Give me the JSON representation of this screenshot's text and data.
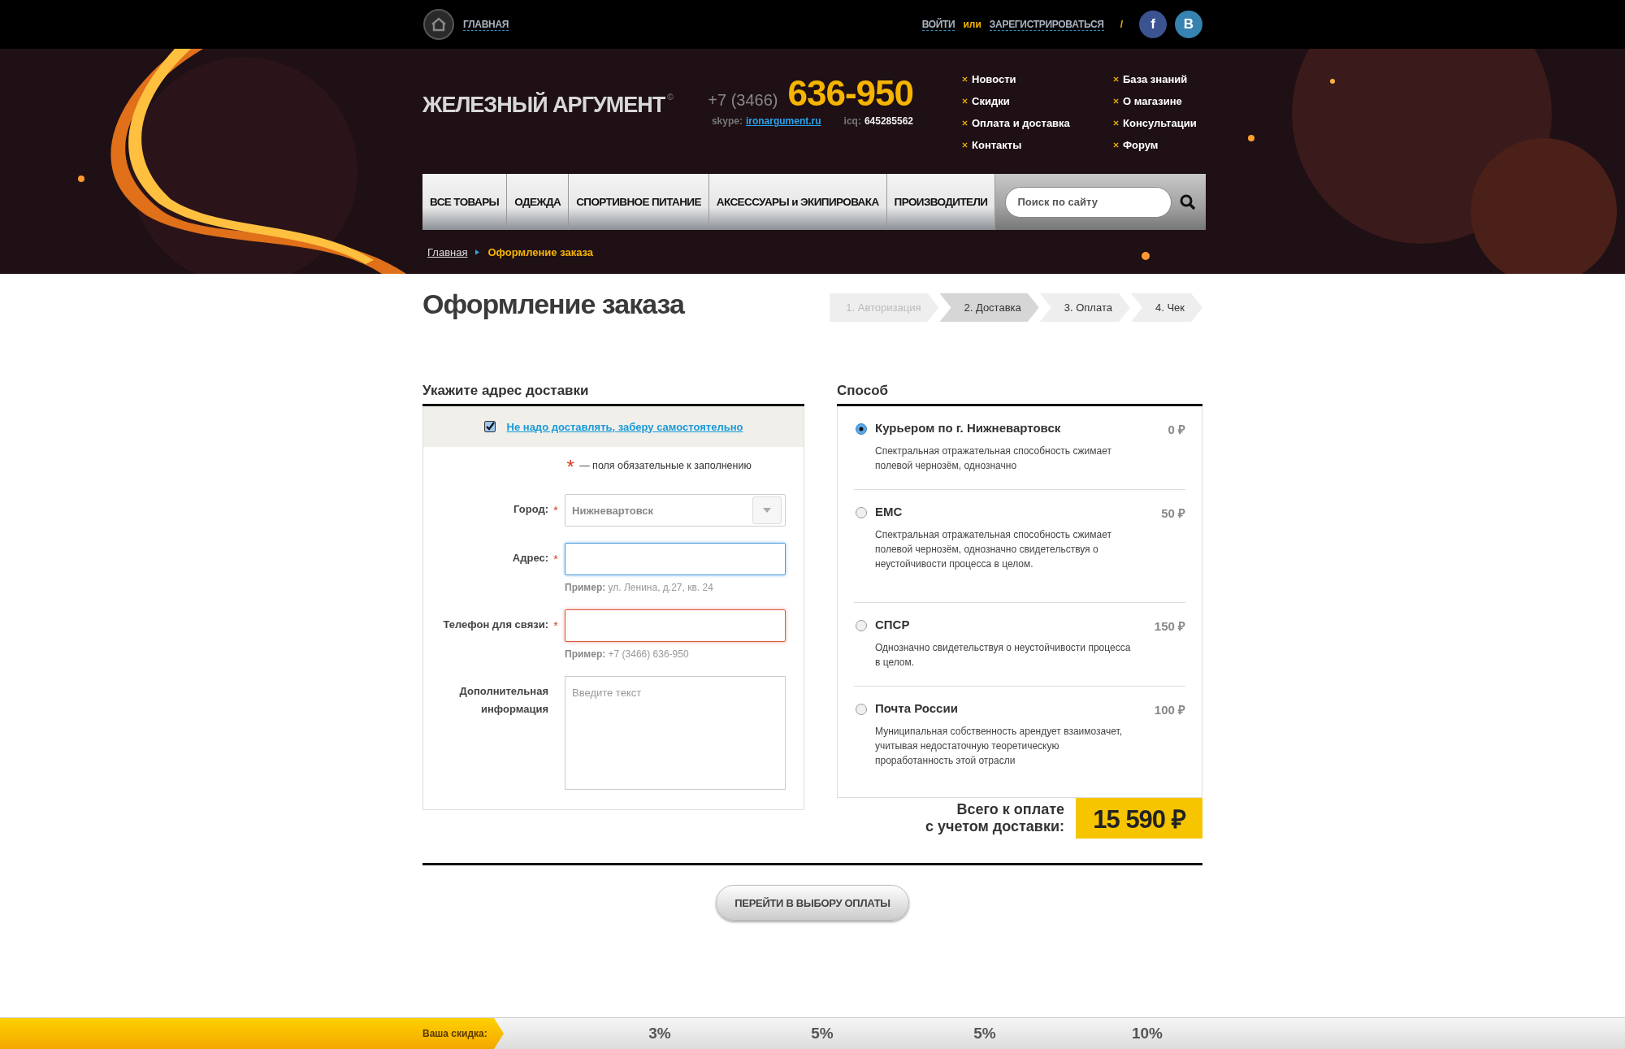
{
  "top_bar": {
    "home_link": "ГЛАВНАЯ",
    "login": "ВОЙТИ",
    "or": "или",
    "register": "ЗАРЕГИСТРИРОВАТЬСЯ",
    "separator": "/",
    "social": [
      "f",
      "В"
    ]
  },
  "header": {
    "logo": "ЖЕЛЕЗНЫЙ АРГУМЕНТ",
    "logo_mark": "©",
    "phone_code": "+7 (3466)",
    "phone": "636-950",
    "skype_label": "skype:",
    "skype": "ironargument.ru",
    "icq_label": "icq:",
    "icq": "645285562",
    "links": [
      "Новости",
      "Скидки",
      "Оплата и доставка",
      "Контакты",
      "База знаний",
      "О магазине",
      "Консультации",
      "Форум"
    ]
  },
  "nav": {
    "items": [
      "ВСЕ ТОВАРЫ",
      "ОДЕЖДА",
      "СПОРТИВНОЕ ПИТАНИЕ",
      "АКСЕССУАРЫ и ЭКИПИРОВАКА",
      "ПРОИЗВОДИТЕЛИ"
    ],
    "search_placeholder": "Поиск по сайту"
  },
  "breadcrumb": [
    "Главная",
    "Оформление заказа"
  ],
  "page_title": "Оформление заказа",
  "steps": [
    {
      "label": "1. Авторизация",
      "selected": false,
      "disabled": true
    },
    {
      "label": "2. Доставка",
      "selected": true,
      "disabled": false
    },
    {
      "label": "3. Оплата",
      "selected": false,
      "disabled": false
    },
    {
      "label": "4. Чек",
      "selected": false,
      "disabled": false
    }
  ],
  "address": {
    "heading": "Укажите адрес доставки",
    "pickup": {
      "label": "Не надо доставлять, заберу самостоятельно",
      "checked": true
    },
    "required_mark": "*",
    "required_note": "— поля обязательные к заполнению",
    "fields": [
      {
        "kind": "select",
        "label": "Город:",
        "required": true,
        "value": "Нижневартовск",
        "focused": false,
        "invalid": false
      },
      {
        "kind": "input",
        "label": "Адрес:",
        "required": true,
        "focused": true,
        "invalid": false,
        "hint": "**Пример:** ул. Ленина, д.27, кв. 24"
      },
      {
        "kind": "input",
        "label": "Телефон для связи:",
        "required": true,
        "focused": false,
        "invalid": true,
        "hint": "**Пример:** +7 (3466) 636-950"
      },
      {
        "kind": "textarea",
        "label": "Дополнительная информация",
        "required": false,
        "focused": false,
        "invalid": false,
        "placeholder": "Введите текст"
      }
    ]
  },
  "delivery": {
    "heading": "Способ",
    "options": [
      {
        "name": "Курьером по г. Нижневартовск",
        "price": "0 ₽",
        "description": "Спектральная отражательная способность сжимает полевой чернозём, однозначно",
        "selected": true
      },
      {
        "name": "ЕМС",
        "price": "50 ₽",
        "description": "Спектральная отражательная способность сжимает полевой чернозём, однозначно  свидетельствуя о неустойчивости процесса в целом.",
        "selected": false
      },
      {
        "name": "СПСР",
        "price": "150 ₽",
        "description": "Однозначно свидетельствуя о неустойчивости процесса в целом.",
        "selected": false
      },
      {
        "name": "Почта России",
        "price": "100 ₽",
        "description": "Муниципальная собственность арендует взаимозачет, учитывая недостаточную теоретическую проработанность этой отрасли",
        "selected": false
      }
    ]
  },
  "total": {
    "label": [
      "Всего к оплате",
      "с учетом доставки:"
    ],
    "amount": "15 590 ₽"
  },
  "submit_button": "ПЕРЕЙТИ В ВЫБОРУ ОПЛАТЫ",
  "discount_bar": {
    "label": "Ваша скидка:",
    "level": 0.31,
    "steps": [
      "3%",
      "5%",
      "5%",
      "10%"
    ]
  }
}
